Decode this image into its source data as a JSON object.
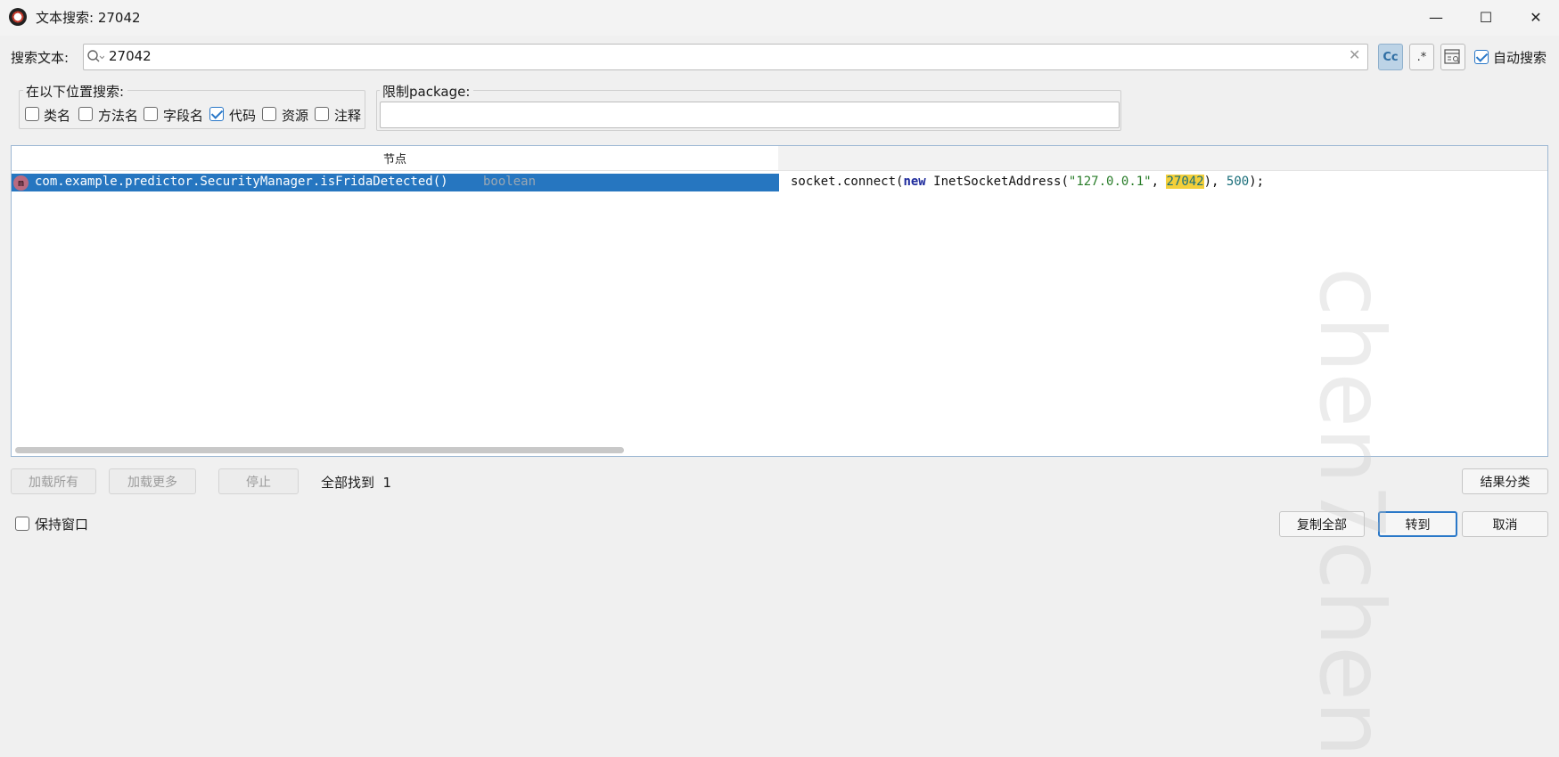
{
  "window": {
    "title": "文本搜索: 27042",
    "minimize_glyph": "—",
    "maximize_glyph": "☐",
    "close_glyph": "✕"
  },
  "search": {
    "label": "搜索文本:",
    "value": "27042",
    "case_label": "Cc",
    "regex_label": ".*",
    "auto_search_label": "自动搜索",
    "auto_search_checked": true
  },
  "locations": {
    "title": "在以下位置搜索:",
    "options": [
      {
        "label": "类名",
        "checked": false
      },
      {
        "label": "方法名",
        "checked": false
      },
      {
        "label": "字段名",
        "checked": false
      },
      {
        "label": "代码",
        "checked": true
      },
      {
        "label": "资源",
        "checked": false
      },
      {
        "label": "注释",
        "checked": false
      }
    ]
  },
  "package_filter": {
    "title": "限制package:",
    "value": ""
  },
  "results": {
    "column_node": "节点",
    "rows": [
      {
        "icon_letter": "m",
        "node": "com.example.predictor.SecurityManager.isFridaDetected()",
        "type": "boolean",
        "code": {
          "prefix": "socket.connect(",
          "kw": "new",
          "mid": " InetSocketAddress(",
          "str": "\"127.0.0.1\"",
          "sep": ", ",
          "hit": "27042",
          "close": "), ",
          "num": "500",
          "end": ");"
        }
      }
    ]
  },
  "buttons": {
    "load_all": "加载所有",
    "load_more": "加载更多",
    "stop": "停止",
    "found": "全部找到  1",
    "classify": "结果分类",
    "keep_window": "保持窗口",
    "copy_all": "复制全部",
    "goto": "转到",
    "cancel": "取消"
  },
  "watermark": "chen7chen",
  "colors": {
    "selection": "#2676c0",
    "match_highlight": "#f3cf3a",
    "accent": "#2a78c8"
  }
}
